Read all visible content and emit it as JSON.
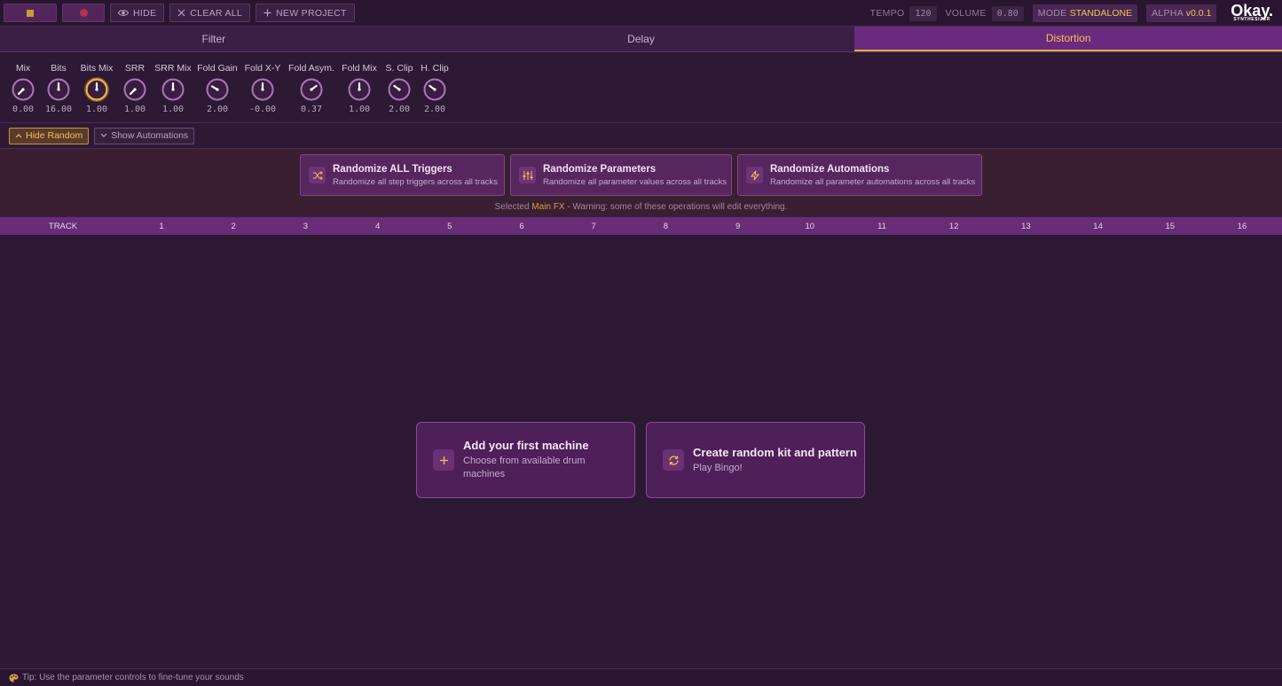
{
  "toolbar": {
    "hide_label": "HIDE",
    "clear_label": "CLEAR ALL",
    "new_project_label": "NEW PROJECT"
  },
  "status": {
    "tempo_label": "TEMPO",
    "tempo_value": "120",
    "volume_label": "VOLUME",
    "volume_value": "0.80",
    "mode_label": "MODE",
    "mode_value": "STANDALONE",
    "alpha_label": "ALPHA",
    "version": "v0.0.1",
    "logo": "Okay.",
    "logo_sub": "SYNTHESIZER"
  },
  "tabs": [
    {
      "label": "Filter",
      "active": false
    },
    {
      "label": "Delay",
      "active": false
    },
    {
      "label": "Distortion",
      "active": true
    }
  ],
  "knobs": [
    {
      "label": "Mix",
      "value": "0.00",
      "level": 0.0
    },
    {
      "label": "Bits",
      "value": "16.00",
      "level": 0.5
    },
    {
      "label": "Bits Mix",
      "value": "1.00",
      "level": 0.5,
      "selected": true
    },
    {
      "label": "SRR",
      "value": "1.00",
      "level": 0.0
    },
    {
      "label": "SRR Mix",
      "value": "1.00",
      "level": 0.5
    },
    {
      "label": "Fold Gain",
      "value": "2.00",
      "level": 0.28
    },
    {
      "label": "Fold X-Y",
      "value": "-0.00",
      "level": 0.5
    },
    {
      "label": "Fold Asym.",
      "value": "0.37",
      "level": 0.7
    },
    {
      "label": "Fold Mix",
      "value": "1.00",
      "level": 0.5
    },
    {
      "label": "S. Clip",
      "value": "2.00",
      "level": 0.3
    },
    {
      "label": "H. Clip",
      "value": "2.00",
      "level": 0.3
    }
  ],
  "random_row": {
    "hide_random": "Hide Random",
    "show_automations": "Show Automations"
  },
  "randomize": [
    {
      "title": "Randomize ALL Triggers",
      "desc": "Randomize all step triggers across all tracks",
      "icon": "shuffle-icon"
    },
    {
      "title": "Randomize Parameters",
      "desc": "Randomize all parameter values across all tracks",
      "icon": "sliders-icon"
    },
    {
      "title": "Randomize Automations",
      "desc": "Randomize all parameter automations across all tracks",
      "icon": "bolt-icon"
    }
  ],
  "warning": {
    "prefix": "Selected",
    "target": "Main FX",
    "suffix": "- Warning: some of these operations will edit everything."
  },
  "track_header": {
    "label": "TRACK",
    "steps": [
      "1",
      "2",
      "3",
      "4",
      "5",
      "6",
      "7",
      "8",
      "9",
      "10",
      "11",
      "12",
      "13",
      "14",
      "15",
      "16"
    ]
  },
  "empty_state": {
    "add_title": "Add your first machine",
    "add_desc": "Choose from available drum machines",
    "random_title": "Create random kit and pattern",
    "random_desc": "Play Bingo!"
  },
  "footer": {
    "tip": "Tip: Use the parameter controls to fine-tune your sounds"
  },
  "colors": {
    "accent": "#f3c24d",
    "active_tab": "#6a2a7e",
    "background": "#2e1934"
  }
}
